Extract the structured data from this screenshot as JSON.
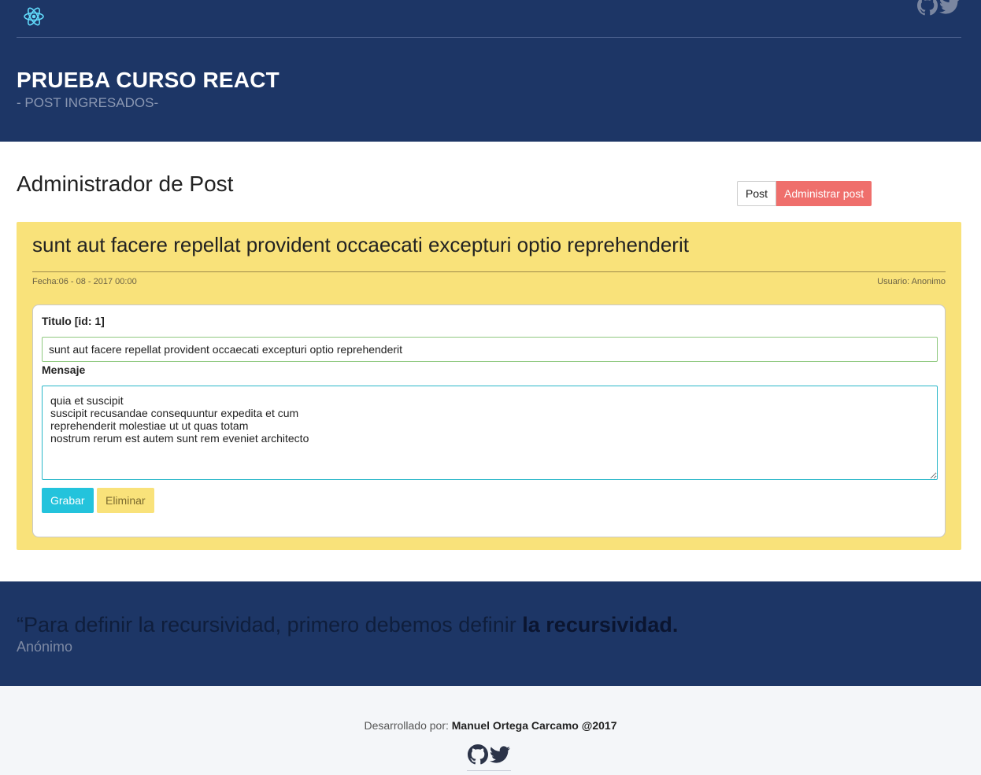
{
  "header": {
    "title": "PRUEBA CURSO REACT",
    "subtitle": "- POST INGRESADOS-",
    "icons": [
      "react-logo-icon",
      "github-icon",
      "twitter-icon"
    ]
  },
  "main": {
    "title": "Administrador de Post",
    "buttons": {
      "post": "Post",
      "admin": "Administrar post"
    }
  },
  "post": {
    "title": "sunt aut facere repellat provident occaecati excepturi optio reprehenderit",
    "date": "Fecha:06 - 08 - 2017 00:00",
    "user": "Usuario: Anonimo"
  },
  "form": {
    "titulo_label": "Titulo [id: 1]",
    "titulo_value": "sunt aut facere repellat provident occaecati excepturi optio reprehenderit",
    "mensaje_label": "Mensaje",
    "mensaje_value": "quia et suscipit\nsuscipit recusandae consequuntur expedita et cum\nreprehenderit molestiae ut ut quas totam\nnostrum rerum est autem sunt rem eveniet architecto",
    "grabar": "Grabar",
    "eliminar": "Eliminar"
  },
  "quote": {
    "text": "“Para definir la recursividad, primero debemos definir ",
    "bold": "la recursividad.",
    "author": "Anónimo"
  },
  "footer": {
    "credit_prefix": "Desarrollado por: ",
    "credit_name": "Manuel Ortega Carcamo @2017",
    "icons": [
      "github-icon",
      "twitter-icon"
    ]
  },
  "colors": {
    "navy": "#1d3666",
    "card_yellow": "#f9e27a",
    "admin_red": "#ef6f6c",
    "grabar_cyan": "#23c3dc"
  }
}
